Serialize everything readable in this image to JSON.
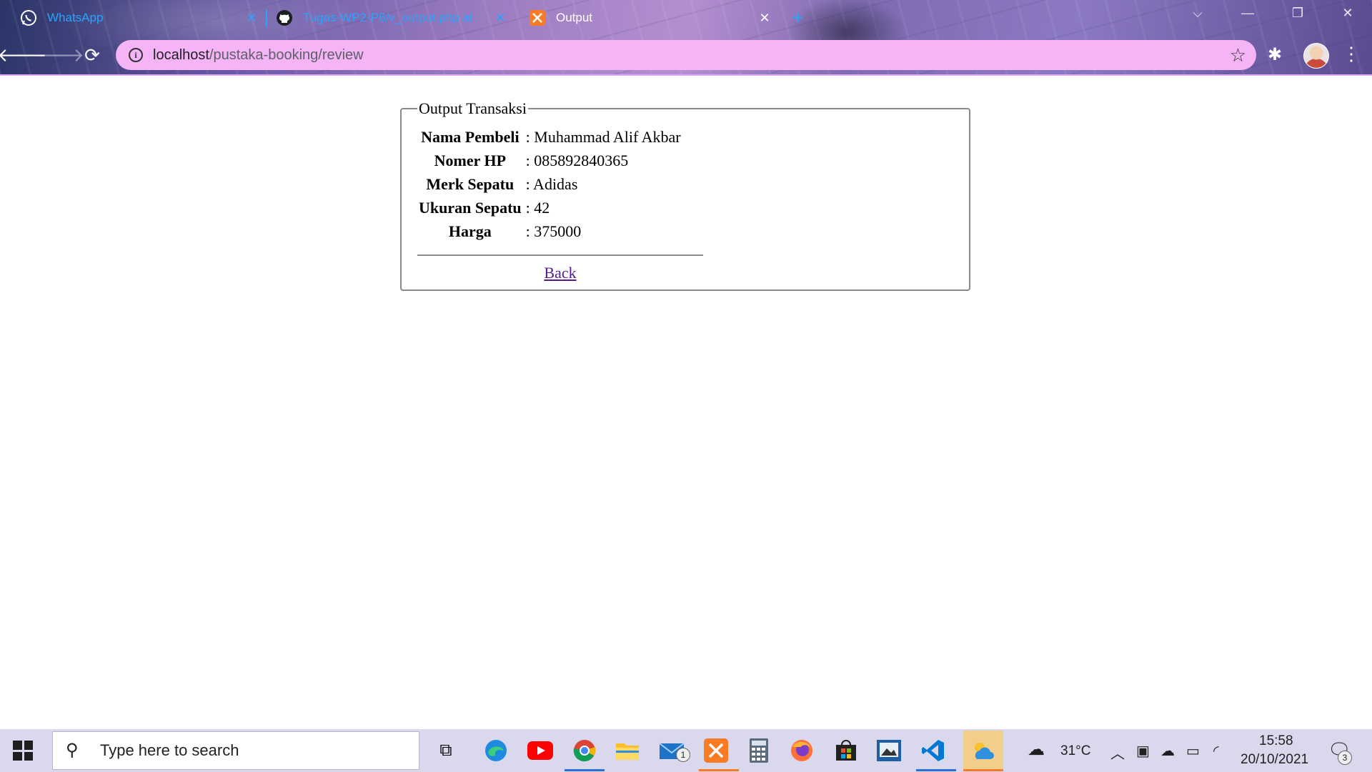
{
  "browser": {
    "tabs": [
      {
        "title": "WhatsApp",
        "icon": "whatsapp-icon",
        "color": "#28a4ff"
      },
      {
        "title": "Tugas-WP2-P6/v_output.php at",
        "icon": "github-icon",
        "color": "#28a4ff"
      },
      {
        "title": "Output",
        "icon": "xampp-icon",
        "color": "#ffffff",
        "active": true
      }
    ],
    "url_host": "localhost",
    "url_path": "/pustaka-booking/review",
    "omnibox_color": "#f4b4f6"
  },
  "page": {
    "legend": "Output Transaksi",
    "rows": [
      {
        "label": "Nama Pembeli",
        "value": ": Muhammad Alif Akbar"
      },
      {
        "label": "Nomer HP",
        "value": ": 085892840365"
      },
      {
        "label": "Merk Sepatu",
        "value": ": Adidas"
      },
      {
        "label": "Ukuran Sepatu",
        "value": ": 42"
      },
      {
        "label": "Harga",
        "value": ": 375000"
      }
    ],
    "back_link": "Back"
  },
  "taskbar": {
    "search_placeholder": "Type here to search",
    "mail_badge": "1",
    "weather": "31°C",
    "time": "15:58",
    "date": "20/10/2021",
    "notification_count": "3",
    "apps": [
      "task-view-icon",
      "edge-icon",
      "youtube-icon",
      "chrome-icon",
      "file-explorer-icon",
      "mail-icon",
      "xampp-icon",
      "calculator-icon",
      "firefox-icon",
      "store-icon",
      "photo-viewer-icon",
      "vscode-icon",
      "weather-app-icon"
    ]
  }
}
